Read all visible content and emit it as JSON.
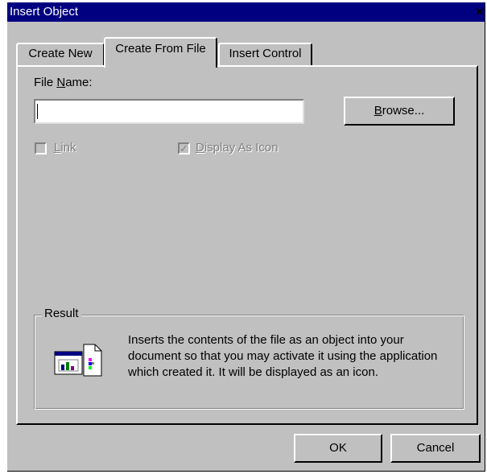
{
  "window": {
    "title": "Insert Object",
    "close_icon": "close-icon"
  },
  "tabs": [
    {
      "label": "Create New",
      "active": false
    },
    {
      "label": "Create From File",
      "active": true
    },
    {
      "label": "Insert Control",
      "active": false
    }
  ],
  "file_name": {
    "label_pre": "File ",
    "label_accel": "N",
    "label_post": "ame:",
    "value": ""
  },
  "browse_button": {
    "accel": "B",
    "rest": "rowse..."
  },
  "link_checkbox": {
    "accel": "L",
    "rest": "ink",
    "checked": false,
    "enabled": false
  },
  "display_as_icon_checkbox": {
    "accel": "D",
    "rest": "isplay As Icon",
    "checked": true,
    "enabled": false
  },
  "result": {
    "title": "Result",
    "text": "Inserts the contents of the file as an object into your document so that you may activate it using the application which created it.  It will be displayed as an icon.",
    "icon": "insert-file-object-icon"
  },
  "buttons": {
    "ok": "OK",
    "cancel": "Cancel"
  }
}
